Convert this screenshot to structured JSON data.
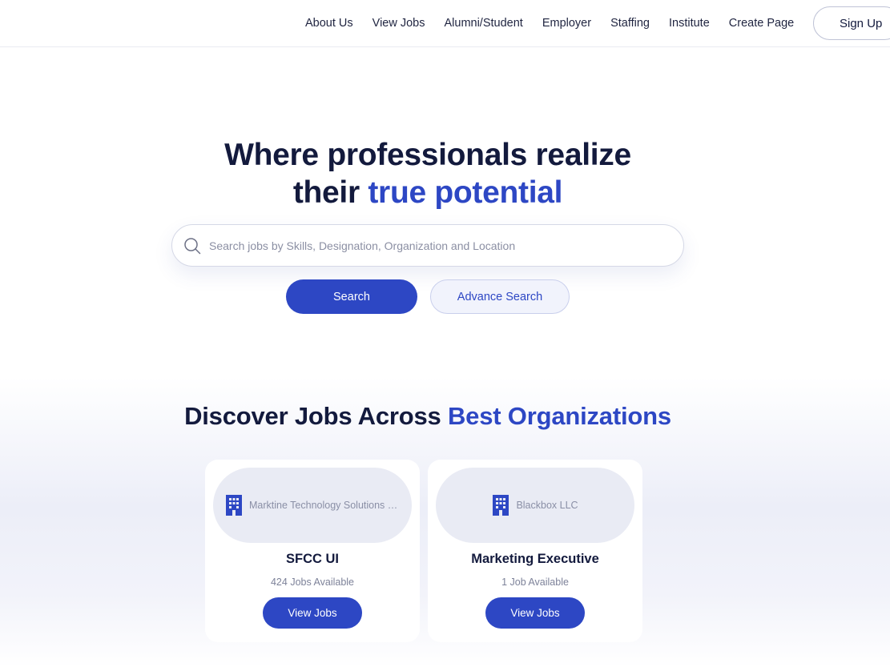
{
  "nav": {
    "links": [
      "About Us",
      "View Jobs",
      "Alumni/Student",
      "Employer",
      "Staffing",
      "Institute",
      "Create Page"
    ],
    "signup_label": "Sign Up"
  },
  "hero": {
    "title_line1": "Where professionals realize",
    "title_line2_plain": "their ",
    "title_line2_accent": "true potential"
  },
  "search": {
    "placeholder": "Search jobs by Skills, Designation, Organization and Location",
    "value": "",
    "search_label": "Search",
    "advance_label": "Advance Search"
  },
  "discover": {
    "title_plain": "Discover Jobs Across ",
    "title_accent": "Best Organizations",
    "cards": [
      {
        "org": "Marktine Technology Solutions P...",
        "title": "SFCC UI",
        "count": "424 Jobs Available",
        "button": "View Jobs"
      },
      {
        "org": "Blackbox LLC",
        "title": "Marketing Executive",
        "count": "1 Job Available",
        "button": "View Jobs"
      }
    ]
  },
  "colors": {
    "accent": "#2d47c4",
    "heading": "#131a3d",
    "muted": "#8a8fa6",
    "logo_bg": "#e9ebf4"
  },
  "icons": [
    "search-icon",
    "building-icon"
  ]
}
